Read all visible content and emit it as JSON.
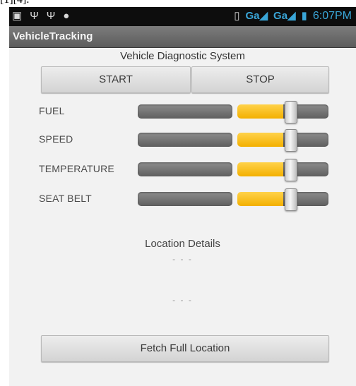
{
  "caption": "[1][4].",
  "status_bar": {
    "left_icons": [
      "image-notification-icon",
      "usb-icon",
      "usb-icon",
      "chat-icon"
    ],
    "network_1": "Ga",
    "network_2": "Ga",
    "time": "6:07PM"
  },
  "app": {
    "title": "VehicleTracking"
  },
  "diagnostic": {
    "heading": "Vehicle Diagnostic System",
    "start_label": "START",
    "stop_label": "STOP",
    "rows": [
      {
        "label": "FUEL",
        "value": 0.8
      },
      {
        "label": "SPEED",
        "value": 0.8
      },
      {
        "label": "TEMPERATURE",
        "value": 0.8
      },
      {
        "label": "SEAT BELT",
        "value": 0.8
      }
    ]
  },
  "location": {
    "title": "Location Details",
    "line_1": "- - -",
    "line_2": "- - -",
    "fetch_label": "Fetch Full Location"
  },
  "colors": {
    "accent": "#f5b800",
    "status_text": "#3aa6d8",
    "title_bar": "#6b6b6b"
  }
}
